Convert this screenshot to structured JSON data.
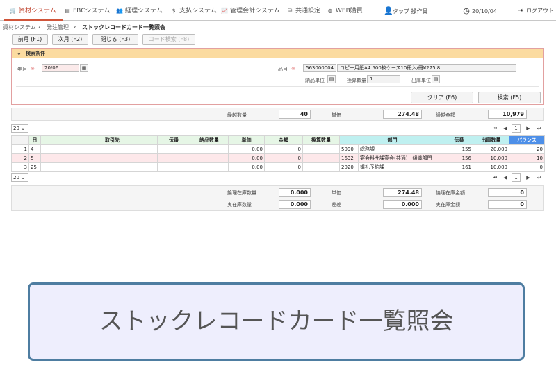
{
  "nav": {
    "items": [
      {
        "label": "資材システム",
        "icon": "cart-icon"
      },
      {
        "label": "FBCシステム",
        "icon": "card-icon"
      },
      {
        "label": "経理システム",
        "icon": "users-icon"
      },
      {
        "label": "支払システム",
        "icon": "dollar-icon"
      },
      {
        "label": "管理会計システム",
        "icon": "chart-icon"
      },
      {
        "label": "共通設定",
        "icon": "sitemap-icon"
      },
      {
        "label": "WEB購買",
        "icon": "globe-icon"
      }
    ],
    "user": "タップ 操作員",
    "date": "20/10/04",
    "logout": "ログアウト"
  },
  "breadcrumb": {
    "items": [
      "資材システム",
      "発注管理"
    ],
    "current": "ストックレコードカード一覧照会"
  },
  "toolbar": {
    "prev": "前月 (F1)",
    "next": "次月 (F2)",
    "close": "閉じる (F3)",
    "code_search": "コード検索 (F8)"
  },
  "search": {
    "title": "検索条件",
    "year_month_label": "年月",
    "year_month_value": "20/06",
    "required_mark": "※",
    "item_label": "品目",
    "item_code": "563000004",
    "item_name": "コピー用紙A4 500枚ケース10冊入/冊¥275.8",
    "delivery_unit_label": "納品単位",
    "conversion_label": "換算数量",
    "conversion_value": "1",
    "issue_unit_label": "出庫単位",
    "clear_button": "クリア (F6)",
    "search_button": "検索 (F5)"
  },
  "carryover": {
    "qty_label": "繰越数量",
    "qty_value": "40",
    "price_label": "単価",
    "price_value": "274.48",
    "amount_label": "繰越金額",
    "amount_value": "10,979"
  },
  "pager": {
    "page_size": "20",
    "current_page": "1",
    "first": "⏮",
    "prev": "◀",
    "next": "▶",
    "last": "⏭"
  },
  "table": {
    "headers": [
      "",
      "日",
      "",
      "取引先",
      "伝番",
      "納品数量",
      "単価",
      "金額",
      "換算数量",
      "部門",
      "",
      "伝番",
      "出庫数量",
      "バランス"
    ],
    "rows": [
      {
        "no": "1",
        "day": "4",
        "c1": "",
        "partner": "",
        "slip_in": "",
        "delivery_qty": "",
        "unit_price": "0.00",
        "amount": "0",
        "conv_qty": "",
        "dept_code": "5090",
        "dept_name": "総務課",
        "slip_out": "155",
        "issue_qty": "20.000",
        "balance": "20"
      },
      {
        "no": "2",
        "day": "5",
        "c1": "",
        "partner": "",
        "slip_in": "",
        "delivery_qty": "",
        "unit_price": "0.00",
        "amount": "0",
        "conv_qty": "",
        "dept_code": "1632",
        "dept_name": "宴会料サ課宴会(共通)　組織部門",
        "slip_out": "156",
        "issue_qty": "10.000",
        "balance": "10"
      },
      {
        "no": "3",
        "day": "25",
        "c1": "",
        "partner": "",
        "slip_in": "",
        "delivery_qty": "",
        "unit_price": "0.00",
        "amount": "0",
        "conv_qty": "",
        "dept_code": "2020",
        "dept_name": "婚礼予約課",
        "slip_out": "161",
        "issue_qty": "10.000",
        "balance": "0"
      }
    ]
  },
  "footer_summary": {
    "logical_stock_qty_label": "論理在庫数量",
    "logical_stock_qty": "0.000",
    "price_label": "単価",
    "price_value": "274.48",
    "logical_stock_amount_label": "論理在庫金額",
    "logical_stock_amount": "0",
    "actual_stock_qty_label": "実在庫数量",
    "actual_stock_qty": "0.000",
    "variance_label": "差差",
    "variance_value": "0.000",
    "actual_stock_amount_label": "実在庫金額",
    "actual_stock_amount": "0"
  },
  "banner": {
    "text": "ストックレコードカード一覧照会"
  }
}
